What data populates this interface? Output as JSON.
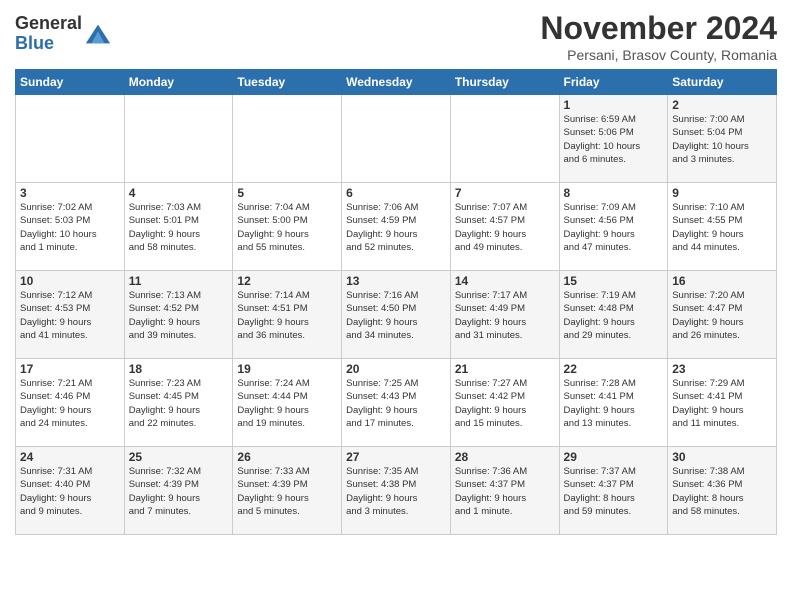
{
  "header": {
    "logo_general": "General",
    "logo_blue": "Blue",
    "month": "November 2024",
    "location": "Persani, Brasov County, Romania"
  },
  "days_of_week": [
    "Sunday",
    "Monday",
    "Tuesday",
    "Wednesday",
    "Thursday",
    "Friday",
    "Saturday"
  ],
  "weeks": [
    [
      {
        "day": "",
        "info": ""
      },
      {
        "day": "",
        "info": ""
      },
      {
        "day": "",
        "info": ""
      },
      {
        "day": "",
        "info": ""
      },
      {
        "day": "",
        "info": ""
      },
      {
        "day": "1",
        "info": "Sunrise: 6:59 AM\nSunset: 5:06 PM\nDaylight: 10 hours\nand 6 minutes."
      },
      {
        "day": "2",
        "info": "Sunrise: 7:00 AM\nSunset: 5:04 PM\nDaylight: 10 hours\nand 3 minutes."
      }
    ],
    [
      {
        "day": "3",
        "info": "Sunrise: 7:02 AM\nSunset: 5:03 PM\nDaylight: 10 hours\nand 1 minute."
      },
      {
        "day": "4",
        "info": "Sunrise: 7:03 AM\nSunset: 5:01 PM\nDaylight: 9 hours\nand 58 minutes."
      },
      {
        "day": "5",
        "info": "Sunrise: 7:04 AM\nSunset: 5:00 PM\nDaylight: 9 hours\nand 55 minutes."
      },
      {
        "day": "6",
        "info": "Sunrise: 7:06 AM\nSunset: 4:59 PM\nDaylight: 9 hours\nand 52 minutes."
      },
      {
        "day": "7",
        "info": "Sunrise: 7:07 AM\nSunset: 4:57 PM\nDaylight: 9 hours\nand 49 minutes."
      },
      {
        "day": "8",
        "info": "Sunrise: 7:09 AM\nSunset: 4:56 PM\nDaylight: 9 hours\nand 47 minutes."
      },
      {
        "day": "9",
        "info": "Sunrise: 7:10 AM\nSunset: 4:55 PM\nDaylight: 9 hours\nand 44 minutes."
      }
    ],
    [
      {
        "day": "10",
        "info": "Sunrise: 7:12 AM\nSunset: 4:53 PM\nDaylight: 9 hours\nand 41 minutes."
      },
      {
        "day": "11",
        "info": "Sunrise: 7:13 AM\nSunset: 4:52 PM\nDaylight: 9 hours\nand 39 minutes."
      },
      {
        "day": "12",
        "info": "Sunrise: 7:14 AM\nSunset: 4:51 PM\nDaylight: 9 hours\nand 36 minutes."
      },
      {
        "day": "13",
        "info": "Sunrise: 7:16 AM\nSunset: 4:50 PM\nDaylight: 9 hours\nand 34 minutes."
      },
      {
        "day": "14",
        "info": "Sunrise: 7:17 AM\nSunset: 4:49 PM\nDaylight: 9 hours\nand 31 minutes."
      },
      {
        "day": "15",
        "info": "Sunrise: 7:19 AM\nSunset: 4:48 PM\nDaylight: 9 hours\nand 29 minutes."
      },
      {
        "day": "16",
        "info": "Sunrise: 7:20 AM\nSunset: 4:47 PM\nDaylight: 9 hours\nand 26 minutes."
      }
    ],
    [
      {
        "day": "17",
        "info": "Sunrise: 7:21 AM\nSunset: 4:46 PM\nDaylight: 9 hours\nand 24 minutes."
      },
      {
        "day": "18",
        "info": "Sunrise: 7:23 AM\nSunset: 4:45 PM\nDaylight: 9 hours\nand 22 minutes."
      },
      {
        "day": "19",
        "info": "Sunrise: 7:24 AM\nSunset: 4:44 PM\nDaylight: 9 hours\nand 19 minutes."
      },
      {
        "day": "20",
        "info": "Sunrise: 7:25 AM\nSunset: 4:43 PM\nDaylight: 9 hours\nand 17 minutes."
      },
      {
        "day": "21",
        "info": "Sunrise: 7:27 AM\nSunset: 4:42 PM\nDaylight: 9 hours\nand 15 minutes."
      },
      {
        "day": "22",
        "info": "Sunrise: 7:28 AM\nSunset: 4:41 PM\nDaylight: 9 hours\nand 13 minutes."
      },
      {
        "day": "23",
        "info": "Sunrise: 7:29 AM\nSunset: 4:41 PM\nDaylight: 9 hours\nand 11 minutes."
      }
    ],
    [
      {
        "day": "24",
        "info": "Sunrise: 7:31 AM\nSunset: 4:40 PM\nDaylight: 9 hours\nand 9 minutes."
      },
      {
        "day": "25",
        "info": "Sunrise: 7:32 AM\nSunset: 4:39 PM\nDaylight: 9 hours\nand 7 minutes."
      },
      {
        "day": "26",
        "info": "Sunrise: 7:33 AM\nSunset: 4:39 PM\nDaylight: 9 hours\nand 5 minutes."
      },
      {
        "day": "27",
        "info": "Sunrise: 7:35 AM\nSunset: 4:38 PM\nDaylight: 9 hours\nand 3 minutes."
      },
      {
        "day": "28",
        "info": "Sunrise: 7:36 AM\nSunset: 4:37 PM\nDaylight: 9 hours\nand 1 minute."
      },
      {
        "day": "29",
        "info": "Sunrise: 7:37 AM\nSunset: 4:37 PM\nDaylight: 8 hours\nand 59 minutes."
      },
      {
        "day": "30",
        "info": "Sunrise: 7:38 AM\nSunset: 4:36 PM\nDaylight: 8 hours\nand 58 minutes."
      }
    ]
  ]
}
